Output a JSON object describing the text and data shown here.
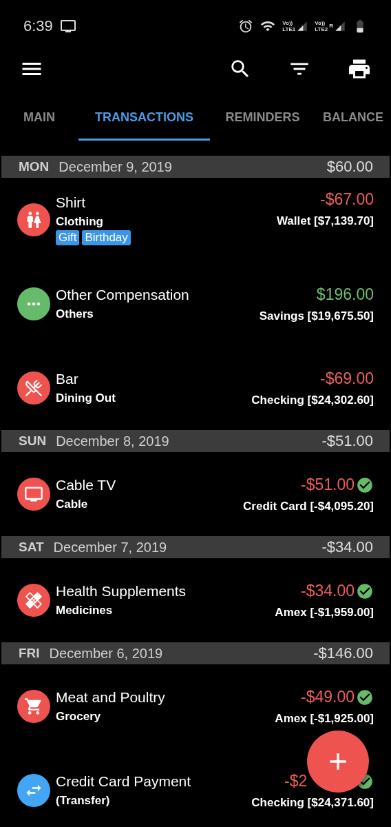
{
  "status_bar": {
    "time": "6:39",
    "sim1": {
      "volte": "Vo))",
      "network": "LTE1"
    },
    "sim2": {
      "volte": "Vo))",
      "network": "LTE2",
      "roaming": "R"
    }
  },
  "tabs": [
    {
      "label": "MAIN",
      "selected": false
    },
    {
      "label": "TRANSACTIONS",
      "selected": true
    },
    {
      "label": "REMINDERS",
      "selected": false
    },
    {
      "label": "BALANCE",
      "selected": false
    }
  ],
  "days": [
    {
      "weekday": "MON",
      "date": "December 9, 2019",
      "total": "$60.00",
      "transactions": [
        {
          "title": "Shirt",
          "category": "Clothing",
          "tags": [
            "Gift",
            "Birthday"
          ],
          "amount": "-$67.00",
          "kind": "expense",
          "account": "Wallet [$7,139.70]",
          "cleared": false,
          "color": "#ef5350"
        },
        {
          "title": "Other Compensation",
          "category": "Others",
          "amount": "$196.00",
          "kind": "income",
          "account": "Savings [$19,675.50]",
          "cleared": false,
          "color": "#66bb6a"
        },
        {
          "title": "Bar",
          "category": "Dining Out",
          "amount": "-$69.00",
          "kind": "expense",
          "account": "Checking [$24,302.60]",
          "cleared": false,
          "color": "#ef5350"
        }
      ]
    },
    {
      "weekday": "SUN",
      "date": "December 8, 2019",
      "total": "-$51.00",
      "transactions": [
        {
          "title": "Cable TV",
          "category": "Cable",
          "amount": "-$51.00",
          "kind": "expense",
          "account": "Credit Card [-$4,095.20]",
          "cleared": true,
          "color": "#ef5350"
        }
      ]
    },
    {
      "weekday": "SAT",
      "date": "December 7, 2019",
      "total": "-$34.00",
      "transactions": [
        {
          "title": "Health Supplements",
          "category": "Medicines",
          "amount": "-$34.00",
          "kind": "expense",
          "account": "Amex [-$1,959.00]",
          "cleared": true,
          "color": "#ef5350"
        }
      ]
    },
    {
      "weekday": "FRI",
      "date": "December 6, 2019",
      "total": "-$146.00",
      "transactions": [
        {
          "title": "Meat and Poultry",
          "category": "Grocery",
          "amount": "-$49.00",
          "kind": "expense",
          "account": "Amex [-$1,925.00]",
          "cleared": true,
          "color": "#ef5350"
        },
        {
          "title": "Credit Card Payment",
          "category": "(Transfer)",
          "amount": "-$2",
          "amount_covered": true,
          "kind": "expense",
          "account": "Checking [$24,371.60]",
          "cleared": true,
          "color": "#42a5f5"
        }
      ]
    }
  ]
}
